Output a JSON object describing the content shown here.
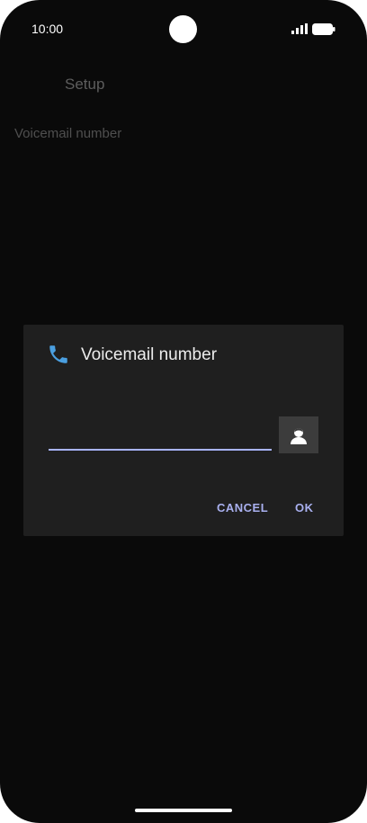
{
  "status_bar": {
    "time": "10:00",
    "icons": [
      "signal-icon",
      "battery-icon"
    ]
  },
  "background": {
    "title": "Setup",
    "item": "Voicemail number"
  },
  "dialog": {
    "icon": "phone-icon",
    "title": "Voicemail number",
    "input_value": "",
    "input_placeholder": "",
    "contact_icon": "contact-icon",
    "cancel_label": "CANCEL",
    "ok_label": "OK"
  },
  "colors": {
    "accent": "#a9b4ff",
    "phone_icon": "#4a9fe0",
    "dialog_bg": "#1f1f1f",
    "screen_bg": "#0a0a0a"
  }
}
